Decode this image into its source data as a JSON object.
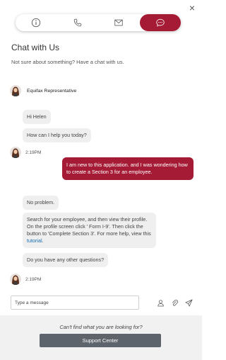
{
  "header": {
    "close_label": "×"
  },
  "tabs": [
    {
      "icon": "info-icon",
      "active": false
    },
    {
      "icon": "phone-icon",
      "active": false
    },
    {
      "icon": "email-icon",
      "active": false
    },
    {
      "icon": "chat-icon",
      "active": true
    }
  ],
  "accent_color": "#a51b35",
  "panel": {
    "title": "Chat with Us",
    "subtitle": "Not sure about something? Have a chat with us."
  },
  "representative": {
    "name": "Equifax Representative"
  },
  "messages": {
    "m1": "Hi Helen",
    "m2": "How can I help you today?",
    "t1": "2:19PM",
    "user1": "I am new to this application. and I was wondering how to create a Section 3 for an employee.",
    "m3": "No problem.",
    "m4_text": "Search for your employee, and then view their profile.  On the profile screen click ' Form I-9'. Then click the button to 'Complete Section 3'. For more help, view this",
    "m4_link": "tutorial",
    "m4_end": ".",
    "m5": "Do you have any other questions?",
    "t2": "2:19PM"
  },
  "composer": {
    "placeholder": "Type a message",
    "icons": [
      "person-icon",
      "attachment-icon",
      "send-icon"
    ]
  },
  "footer": {
    "prompt": "Can't find what you are looking for?",
    "button_label": "Support Center"
  }
}
